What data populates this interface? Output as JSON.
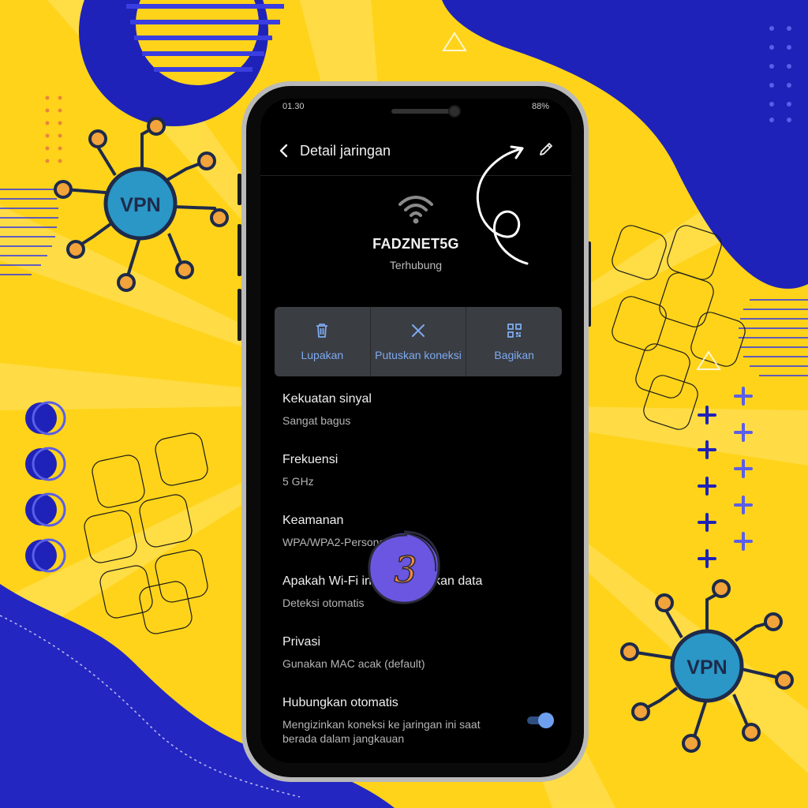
{
  "status_bar": {
    "time": "01.30",
    "battery": "88%"
  },
  "appbar": {
    "title": "Detail jaringan"
  },
  "network": {
    "name": "FADZNET5G",
    "status": "Terhubung"
  },
  "actions": [
    {
      "label": "Lupakan",
      "icon": "trash-icon"
    },
    {
      "label": "Putuskan koneksi",
      "icon": "close-icon"
    },
    {
      "label": "Bagikan",
      "icon": "qr-code-icon"
    }
  ],
  "details": [
    {
      "title": "Kekuatan sinyal",
      "value": "Sangat bagus"
    },
    {
      "title": "Frekuensi",
      "value": "5 GHz"
    },
    {
      "title": "Keamanan",
      "value": "WPA/WPA2-Personal"
    },
    {
      "title": "Apakah Wi-Fi ini mengukurkan data",
      "value": "Deteksi otomatis"
    },
    {
      "title": "Privasi",
      "value": "Gunakan MAC acak (default)"
    },
    {
      "title": "Hubungkan otomatis",
      "value": "Mengizinkan koneksi ke jaringan ini saat berada dalam jangkauan"
    }
  ],
  "auto_connect_enabled": true,
  "step_badge": "3",
  "decor": {
    "vpn_label": "VPN"
  },
  "colors": {
    "background": "#FFD31A",
    "navy": "#1E22B8",
    "accent_blue": "#7EAAF0",
    "vpn_node": "#2A97C6",
    "badge": "#6A56E0"
  }
}
